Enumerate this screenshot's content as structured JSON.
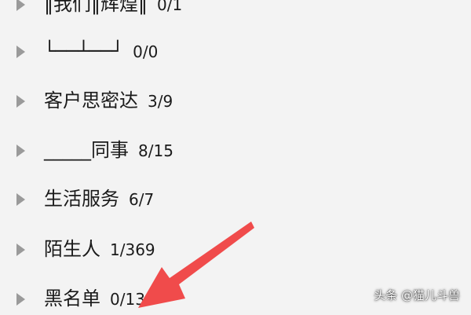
{
  "groups": [
    {
      "name": "‖我们‖辉煌‖",
      "count": "0/1"
    },
    {
      "name": "└──┴──┘",
      "count": "0/0"
    },
    {
      "name": "客户思密达",
      "count": "3/9"
    },
    {
      "name": "_____同事",
      "count": "8/15"
    },
    {
      "name": "生活服务",
      "count": "6/7"
    },
    {
      "name": "陌生人",
      "count": "1/369"
    },
    {
      "name": "黑名单",
      "count": "0/13"
    }
  ],
  "watermark": "头条 @猫儿斗兽",
  "colors": {
    "chevron": "#9a9a9a",
    "arrow": "#f04b4b",
    "background": "#f3f3f3"
  },
  "icons": {
    "expand": "chevron-right-icon",
    "annotation": "red-arrow-icon"
  }
}
